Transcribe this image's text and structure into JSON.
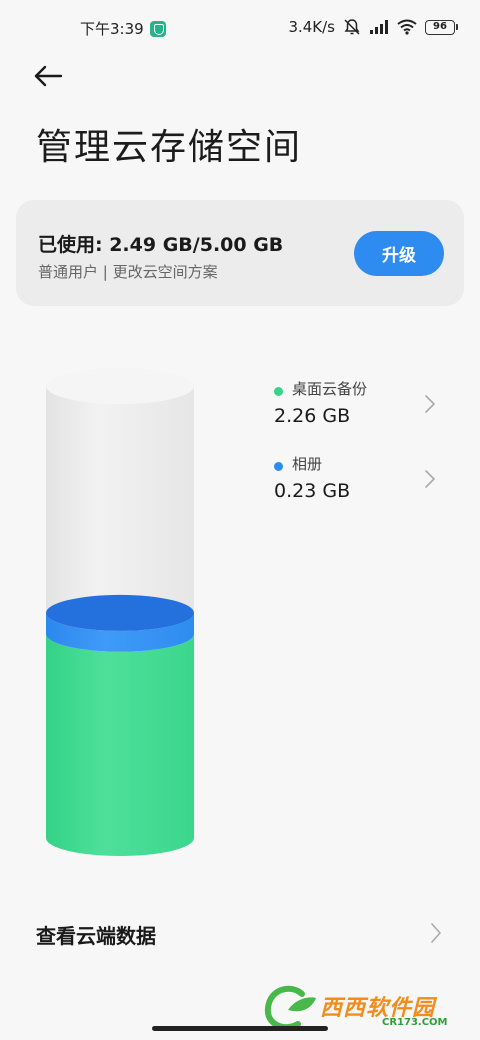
{
  "status_bar": {
    "time": "下午3:39",
    "network_speed": "3.4K/s",
    "battery_level": "96",
    "icons": [
      "shield-icon",
      "mute-icon",
      "signal-icon",
      "wifi-icon",
      "battery-icon"
    ]
  },
  "header": {
    "back_icon": "back-arrow-icon",
    "title": "管理云存储空间"
  },
  "usage_card": {
    "usage_label": "已使用: 2.49 GB/5.00 GB",
    "plan_label": "普通用户 | 更改云空间方案",
    "upgrade_label": "升级"
  },
  "storage": {
    "used_gb": 2.49,
    "total_gb": 5.0,
    "items": [
      {
        "name": "桌面云备份",
        "value": "2.26 GB",
        "color": "#36d48a"
      },
      {
        "name": "相册",
        "value": "0.23 GB",
        "color": "#2e8cf0"
      }
    ]
  },
  "cloud_data": {
    "label": "查看云端数据"
  },
  "watermark": {
    "text": "西西软件园",
    "subtext": "CR173.COM"
  },
  "colors": {
    "accent": "#2e8cf0",
    "green": "#36d48a",
    "blue": "#2e8cf0"
  }
}
